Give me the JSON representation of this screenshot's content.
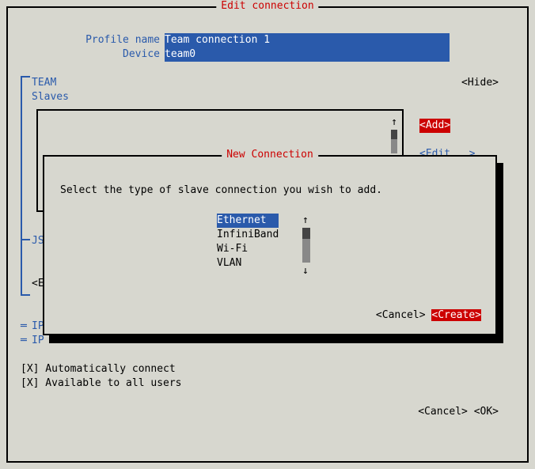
{
  "title": "Edit connection",
  "profile": {
    "label": "Profile name",
    "value": "Team connection 1"
  },
  "device": {
    "label": "Device",
    "value": "team0"
  },
  "team_label": "TEAM",
  "slaves_label": "Slaves",
  "hide_label": "<Hide>",
  "add_label": "<Add>",
  "edit_label": "<Edit...>",
  "js_label": "JS",
  "edit_json_stub": "<E",
  "ip4": "IP",
  "ip6": "IP",
  "chk1": {
    "mark": "[X]",
    "label": " Automatically connect"
  },
  "chk2": {
    "mark": "[X]",
    "label": " Available to all users"
  },
  "cancel_label": "<Cancel>",
  "ok_label": "<OK>",
  "dialog": {
    "title": "New Connection",
    "text": "Select the type of slave connection you wish to add.",
    "types": [
      "Ethernet",
      "InfiniBand",
      "Wi-Fi",
      "VLAN"
    ],
    "cancel": "<Cancel>",
    "create": "<Create>"
  }
}
